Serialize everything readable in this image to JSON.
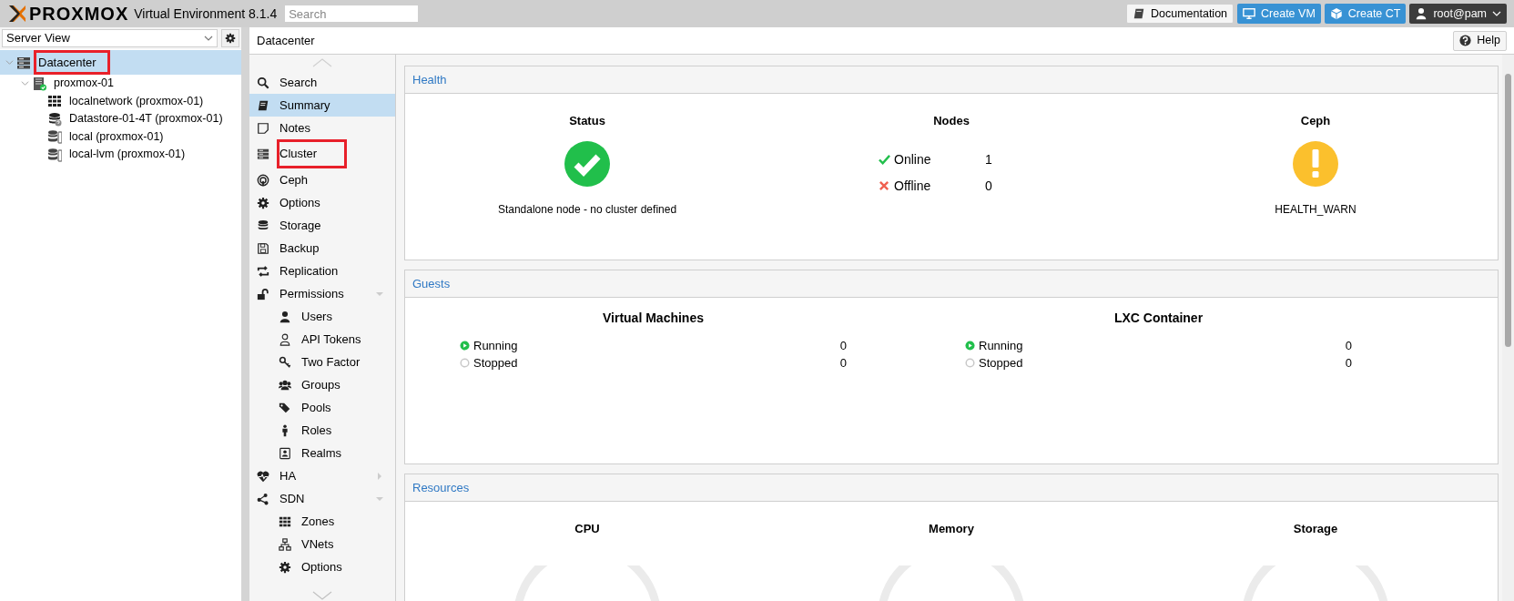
{
  "topbar": {
    "logo": "PROXMOX",
    "product": "Virtual Environment 8.1.4",
    "search": {
      "placeholder": "Search"
    },
    "buttons": [
      {
        "kind": "doc",
        "label": "Documentation"
      },
      {
        "kind": "vm",
        "label": "Create VM"
      },
      {
        "kind": "ct",
        "label": "Create CT"
      },
      {
        "kind": "user",
        "label": "root@pam"
      }
    ]
  },
  "sidebar": {
    "view": "Server View",
    "tree": [
      {
        "kind": "datacenter",
        "label": "Datacenter",
        "selected": true,
        "expanded": true,
        "highlighted": true,
        "children": [
          {
            "kind": "node",
            "label": "proxmox-01",
            "selected": false,
            "expanded": true,
            "highlighted": false,
            "children": [
              {
                "kind": "network",
                "label": "localnetwork (proxmox-01)",
                "selected": false,
                "highlighted": false
              },
              {
                "kind": "storage-unknown",
                "label": "Datastore-01-4T (proxmox-01)",
                "selected": false,
                "highlighted": false
              },
              {
                "kind": "storage",
                "label": "local (proxmox-01)",
                "selected": false,
                "highlighted": false
              },
              {
                "kind": "storage",
                "label": "local-lvm (proxmox-01)",
                "selected": false,
                "highlighted": false
              }
            ]
          }
        ]
      }
    ]
  },
  "content": {
    "title": "Datacenter",
    "help": "Help"
  },
  "nav": [
    {
      "label": "Search",
      "selected": false,
      "highlighted": false
    },
    {
      "label": "Summary",
      "selected": true,
      "highlighted": false
    },
    {
      "label": "Notes",
      "selected": false,
      "highlighted": false
    },
    {
      "label": "Cluster",
      "selected": false,
      "highlighted": true
    },
    {
      "label": "Ceph",
      "selected": false,
      "highlighted": false
    },
    {
      "label": "Options",
      "selected": false,
      "highlighted": false
    },
    {
      "label": "Storage",
      "selected": false,
      "highlighted": false
    },
    {
      "label": "Backup",
      "selected": false,
      "highlighted": false
    },
    {
      "label": "Replication",
      "selected": false,
      "highlighted": false
    },
    {
      "label": "Permissions",
      "selected": false,
      "highlighted": false,
      "expanded": true,
      "children": [
        {
          "label": "Users",
          "selected": false,
          "highlighted": false
        },
        {
          "label": "API Tokens",
          "selected": false,
          "highlighted": false
        },
        {
          "label": "Two Factor",
          "selected": false,
          "highlighted": false
        },
        {
          "label": "Groups",
          "selected": false,
          "highlighted": false
        },
        {
          "label": "Pools",
          "selected": false,
          "highlighted": false
        },
        {
          "label": "Roles",
          "selected": false,
          "highlighted": false
        },
        {
          "label": "Realms",
          "selected": false,
          "highlighted": false
        }
      ]
    },
    {
      "label": "HA",
      "selected": false,
      "highlighted": false,
      "expanded": false
    },
    {
      "label": "SDN",
      "selected": false,
      "highlighted": false,
      "expanded": true,
      "children": [
        {
          "label": "Zones",
          "selected": false,
          "highlighted": false
        },
        {
          "label": "VNets",
          "selected": false,
          "highlighted": false
        },
        {
          "label": "Options",
          "selected": false,
          "highlighted": false
        }
      ]
    }
  ],
  "health": {
    "title": "Health",
    "status": {
      "heading": "Status",
      "kind": "ok",
      "text": "Standalone node - no cluster defined"
    },
    "nodes": {
      "heading": "Nodes",
      "rows": [
        {
          "kind": "online",
          "label": "Online",
          "count": "1"
        },
        {
          "kind": "offline",
          "label": "Offline",
          "count": "0"
        }
      ]
    },
    "ceph": {
      "heading": "Ceph",
      "kind": "warn",
      "text": "HEALTH_WARN"
    }
  },
  "guests": {
    "title": "Guests",
    "groups": [
      {
        "heading": "Virtual Machines",
        "rows": [
          {
            "kind": "running",
            "label": "Running",
            "count": "0"
          },
          {
            "kind": "stopped",
            "label": "Stopped",
            "count": "0"
          }
        ]
      },
      {
        "heading": "LXC Container",
        "rows": [
          {
            "kind": "running",
            "label": "Running",
            "count": "0"
          },
          {
            "kind": "stopped",
            "label": "Stopped",
            "count": "0"
          }
        ]
      }
    ]
  },
  "resources": {
    "title": "Resources",
    "gauges": [
      {
        "heading": "CPU"
      },
      {
        "heading": "Memory"
      },
      {
        "heading": "Storage"
      }
    ]
  }
}
